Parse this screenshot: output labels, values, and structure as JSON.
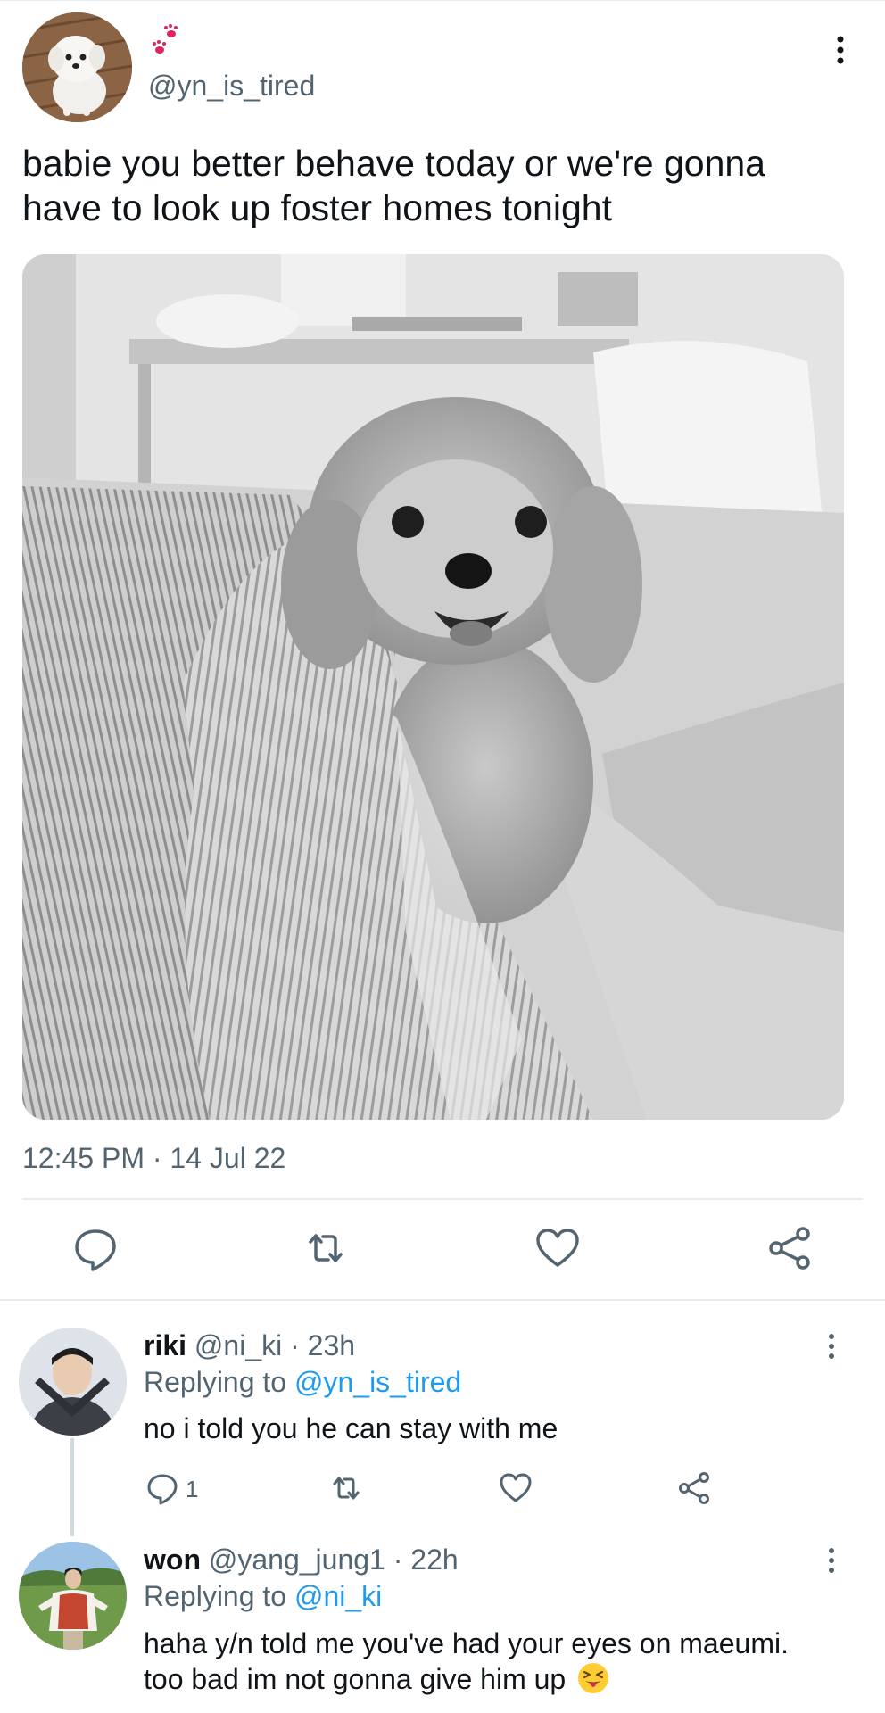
{
  "tweet": {
    "handle": "@yn_is_tired",
    "name_icon": "paw-prints-icon",
    "text_line1": "babie you better behave today or we're gonna",
    "text_line2": "have to look up foster homes tonight",
    "media_description": "black-and-white photo of a fluffy dog wrapped in striped bedsheets",
    "time": "12:45 PM",
    "separator": "·",
    "date": "14 Jul 22",
    "actions": [
      "reply-icon",
      "retweet-icon",
      "like-icon",
      "share-icon"
    ]
  },
  "replies": [
    {
      "name": "riki",
      "handle": "@ni_ki",
      "separator": "·",
      "age": "23h",
      "replying_prefix": "Replying to",
      "replying_to": "@yn_is_tired",
      "text_line1": "no i told you he can stay with me",
      "reply_count": "1"
    },
    {
      "name": "won",
      "handle": "@yang_jung1",
      "separator": "·",
      "age": "22h",
      "replying_prefix": "Replying to",
      "replying_to": "@ni_ki",
      "text_line1": "haha y/n told me you've had your eyes on maeumi.",
      "text_line2": "too bad im not gonna give him up",
      "emoji": "squinting-face-with-tongue-emoji"
    }
  ],
  "colors": {
    "text": "#0f1419",
    "secondary": "#536471",
    "link": "#1d9bf0",
    "divider": "#e6ecf0",
    "paw": "#e0245e"
  }
}
